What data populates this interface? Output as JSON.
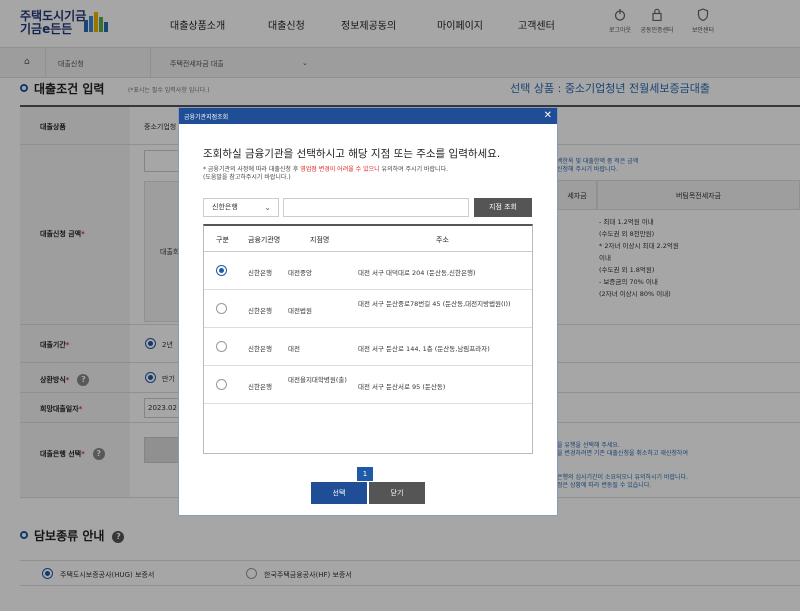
{
  "header": {
    "logo_line1": "주택도시기금",
    "logo_line2": "기금e든든",
    "nav": [
      "대출상품소개",
      "대출신청",
      "정보제공동의",
      "마이페이지",
      "고객센터"
    ],
    "utils": [
      "로그아웃",
      "공동인증센터",
      "보안센터"
    ]
  },
  "breadcrumb": {
    "item1": "대출신청",
    "item2": "주택전세자금 대출"
  },
  "form": {
    "title": "대출조건 입력",
    "required_note": "(*표시는 필수 입력사항 입니다.)",
    "selected_product": "선택 상품 : 중소기업청년 전월세보증금대출",
    "product_label": "대출상품",
    "product_value": "중소기업청",
    "amount_label": "대출신청 금액",
    "amount_sub": "대출희",
    "period_label": "대출기간",
    "period_value": "2년",
    "repay_label": "상환방식",
    "repay_value": "만기",
    "date_label": "희망대출일자",
    "date_value": "2023.02",
    "bank_label": "대출은행 선택",
    "right_note_top": [
      "백한옥 및 대출한액 중 적은 금액",
      "신청해 주시기 바랍니다."
    ],
    "right_head1": "세자금",
    "right_head2": "버팀목전세자금",
    "right_body": [
      "- 최대 1.2억원 이내",
      "(수도권 외 8천만원)",
      "* 2자녀 이상시 최대 2.2억원",
      "이내",
      "(수도권 외 1.8억원)",
      "- 보증금의 70% 이내",
      "(2자녀 이상시 80% 이내)"
    ],
    "right_note_bottom1": [
      "을 유행을 선택해 주세요.",
      "을 변경하려면 기존 대출신청을 취소하고 재신청하여"
    ],
    "right_note_bottom2": [
      "은행의 심사기간이 소요되오니 유의하시기 바랍니다.",
      "정은 상황에 따라 변동될 수 있습니다."
    ]
  },
  "collateral": {
    "title": "담보종류 안내",
    "option1": "주택도시보증공사(HUG) 보증서",
    "option2": "한국주택금융공사(HF) 보증서"
  },
  "modal": {
    "bar_title": "금융기관지점조회",
    "close": "✕",
    "heading": "조회하실 금융기관을 선택하시고 해당 지점 또는 주소를 입력하세요.",
    "note_line1_a": "* 금융기관의 사정에 따라 대출신청 후 ",
    "note_line1_red": "영업점 변경이 어려울 수 있으니",
    "note_line1_b": " 유의하여 주시기 바랍니다.",
    "note_line2": "(도움말을 참고하주시기 바랍니다.)",
    "bank_select": "신한은행",
    "branch_placeholder": "",
    "search_button": "지점 조회",
    "columns": [
      "구분",
      "금융기관명",
      "지점명",
      "주소"
    ],
    "rows": [
      {
        "bank": "신한은행",
        "branch": "대전중앙",
        "address": "대전 서구 대덕대로 204 (둔산동,신한은행)",
        "selected": true
      },
      {
        "bank": "신한은행",
        "branch": "대전법원",
        "address": "대전 서구 둔산중로78번길 45 (둔산동,대전지방법원(I))",
        "selected": false
      },
      {
        "bank": "신한은행",
        "branch": "대전",
        "address": "대전 서구 둔산로 144, 1층 (둔산동,남림프라자)",
        "selected": false
      },
      {
        "bank": "신한은행",
        "branch": "대전을지대학병원(출)",
        "address": "대전 서구 둔산서로 95 (둔산동)",
        "selected": false
      }
    ],
    "page": "1",
    "ok_button": "선택",
    "close_button": "닫기"
  }
}
